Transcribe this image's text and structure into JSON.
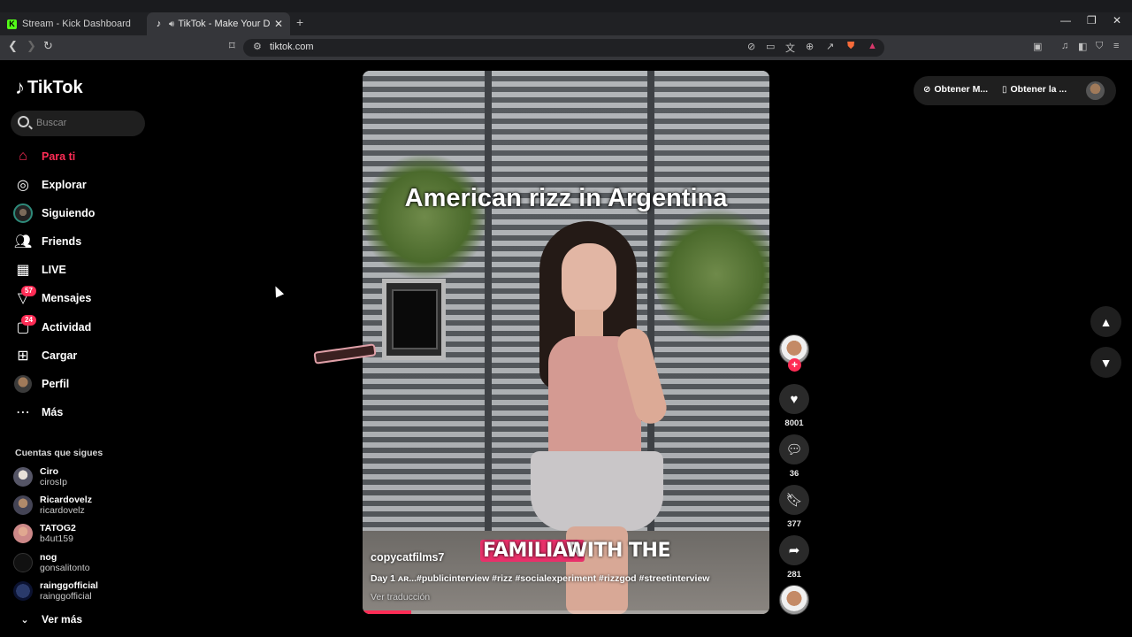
{
  "browser": {
    "tabs": [
      {
        "title": "Stream - Kick Dashboard",
        "favicon": "kick-icon",
        "active": false
      },
      {
        "title": "TikTok - Make Your Day",
        "favicon": "tiktok-icon",
        "active": true
      }
    ],
    "url": "tiktok.com"
  },
  "app": {
    "logo_text": "TikTok",
    "search_placeholder": "Buscar"
  },
  "nav": [
    {
      "label": "Para ti",
      "icon": "home-icon",
      "active": true
    },
    {
      "label": "Explorar",
      "icon": "compass-icon"
    },
    {
      "label": "Siguiendo",
      "icon": "following-avatar-icon"
    },
    {
      "label": "Friends",
      "icon": "friends-icon"
    },
    {
      "label": "LIVE",
      "icon": "live-icon"
    },
    {
      "label": "Mensajes",
      "icon": "messages-icon",
      "badge": "57"
    },
    {
      "label": "Actividad",
      "icon": "activity-icon",
      "badge": "24"
    },
    {
      "label": "Cargar",
      "icon": "upload-icon"
    },
    {
      "label": "Perfil",
      "icon": "profile-avatar-icon"
    },
    {
      "label": "Más",
      "icon": "more-icon"
    }
  ],
  "following": {
    "title": "Cuentas que sigues",
    "accounts": [
      {
        "name": "Ciro",
        "user": "cirosIp"
      },
      {
        "name": "Ricardovelz",
        "user": "ricardovelz"
      },
      {
        "name": "TATOG2",
        "user": "b4ut159"
      },
      {
        "name": "nog",
        "user": "gonsalitonto"
      },
      {
        "name": "rainggofficial",
        "user": "rainggofficial"
      }
    ],
    "see_more": "Ver más"
  },
  "video": {
    "title": "American rizz in Argentina",
    "caption_highlight": "FAMILIAR",
    "caption_rest": "WITH THE",
    "author": "copycatfilms7",
    "description": "Day 1 ᴀʀ...#publicinterview #rizz #socialexperiment #rizzgod #streetinterview",
    "translate": "Ver traducción",
    "progress": 0.12
  },
  "actions": {
    "likes": "8001",
    "comments": "36",
    "saves": "377",
    "shares": "281"
  },
  "topright": {
    "btn1": "Obtener M...",
    "btn2": "Obtener la ..."
  },
  "colors": {
    "accent": "#fe2c55",
    "background": "#000000"
  }
}
